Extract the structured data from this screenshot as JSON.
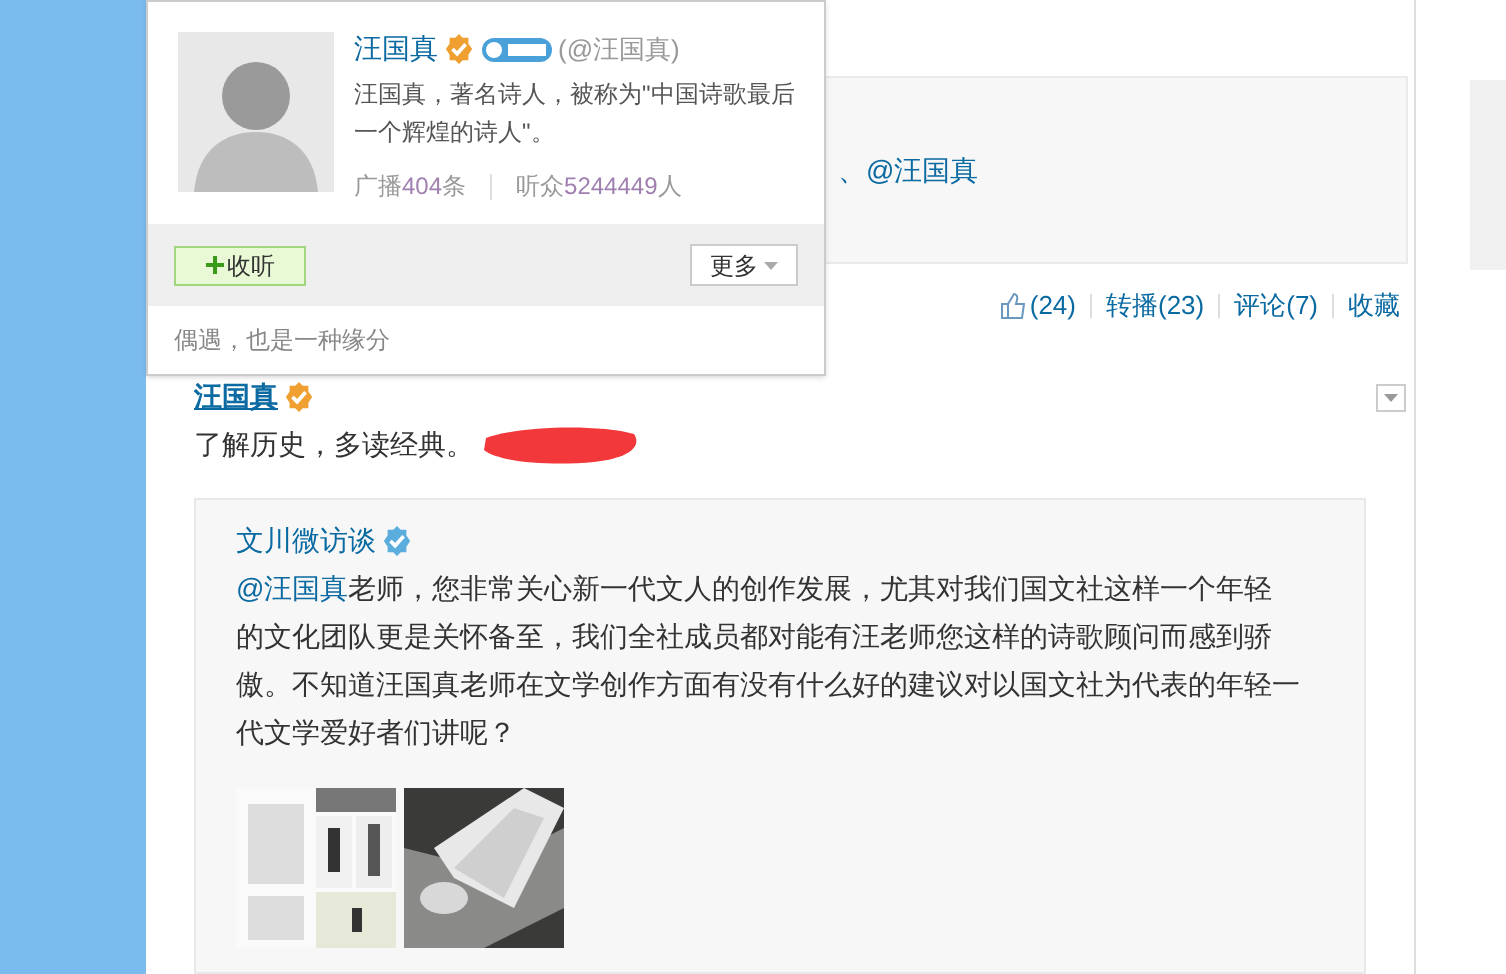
{
  "profile_card": {
    "name": "汪国真",
    "handle": "(@汪国真)",
    "verified": true,
    "bio": "汪国真，著名诗人，被称为\"中国诗歌最后一个辉煌的诗人\"。",
    "stats": [
      {
        "label": "广播",
        "count": "404",
        "unit": "条"
      },
      {
        "label": "听众",
        "count": "5244449",
        "unit": "人"
      }
    ],
    "follow_button": "收听",
    "more_button": "更多",
    "motto": "偶遇，也是一种缘分"
  },
  "previous_post": {
    "mention": "、@汪国真",
    "actions": [
      {
        "kind": "like",
        "label": "(24)"
      },
      {
        "kind": "text",
        "label": "转播(23)"
      },
      {
        "kind": "text",
        "label": "评论(7)"
      },
      {
        "kind": "text",
        "label": "收藏"
      }
    ]
  },
  "post": {
    "author": "汪国真",
    "verified": true,
    "text": "了解历史，多读经典。",
    "quote": {
      "author": "文川微访谈",
      "verified": true,
      "mention": "@汪国真",
      "text": "老师，您非常关心新一代文人的创作发展，尤其对我们国文社这样一个年轻的文化团队更是关怀备至，我们全社成员都对能有汪老师您这样的诗歌顾问而感到骄傲。不知道汪国真老师在文学创作方面有没有什么好的建议对以国文社为代表的年轻一代文学爱好者们讲呢？"
    }
  }
}
